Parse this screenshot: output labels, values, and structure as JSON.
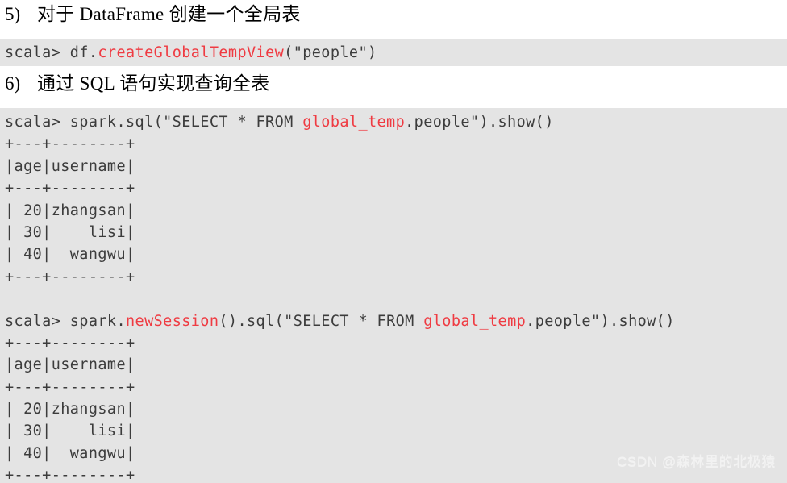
{
  "document": {
    "background_color": "#ffffff",
    "code_block_color": "#e4e4e4",
    "code_text_color": "#3c3c3c",
    "accent_color": "#ef3b42"
  },
  "headings": [
    {
      "number": "5)",
      "text": "对于 DataFrame 创建一个全局表"
    },
    {
      "number": "6)",
      "text": "通过 SQL 语句实现查询全表"
    }
  ],
  "code_block_1": {
    "lines": [
      {
        "segments": [
          {
            "text": "scala> df.",
            "color": "plain"
          },
          {
            "text": "createGlobalTempView",
            "color": "red"
          },
          {
            "text": "(\"people\")",
            "color": "plain"
          }
        ]
      }
    ]
  },
  "code_block_2": {
    "lines": [
      {
        "segments": [
          {
            "text": "scala> spark.sql(\"SELECT * FROM ",
            "color": "plain"
          },
          {
            "text": "global_temp",
            "color": "red"
          },
          {
            "text": ".people\").show()",
            "color": "plain"
          }
        ]
      },
      {
        "segments": [
          {
            "text": "+---+--------+",
            "color": "plain"
          }
        ]
      },
      {
        "segments": [
          {
            "text": "|age|username|",
            "color": "plain"
          }
        ]
      },
      {
        "segments": [
          {
            "text": "+---+--------+",
            "color": "plain"
          }
        ]
      },
      {
        "segments": [
          {
            "text": "| 20|zhangsan|",
            "color": "plain"
          }
        ]
      },
      {
        "segments": [
          {
            "text": "| 30|    lisi|",
            "color": "plain"
          }
        ]
      },
      {
        "segments": [
          {
            "text": "| 40|  wangwu|",
            "color": "plain"
          }
        ]
      },
      {
        "segments": [
          {
            "text": "+---+--------+",
            "color": "plain"
          }
        ]
      },
      {
        "segments": [
          {
            "text": "",
            "color": "plain"
          }
        ]
      },
      {
        "segments": [
          {
            "text": "scala> spark.",
            "color": "plain"
          },
          {
            "text": "newSession",
            "color": "red"
          },
          {
            "text": "().sql(\"SELECT * FROM ",
            "color": "plain"
          },
          {
            "text": "global_temp",
            "color": "red"
          },
          {
            "text": ".people\").show()",
            "color": "plain"
          }
        ]
      },
      {
        "segments": [
          {
            "text": "+---+--------+",
            "color": "plain"
          }
        ]
      },
      {
        "segments": [
          {
            "text": "|age|username|",
            "color": "plain"
          }
        ]
      },
      {
        "segments": [
          {
            "text": "+---+--------+",
            "color": "plain"
          }
        ]
      },
      {
        "segments": [
          {
            "text": "| 20|zhangsan|",
            "color": "plain"
          }
        ]
      },
      {
        "segments": [
          {
            "text": "| 30|    lisi|",
            "color": "plain"
          }
        ]
      },
      {
        "segments": [
          {
            "text": "| 40|  wangwu|",
            "color": "plain"
          }
        ]
      },
      {
        "segments": [
          {
            "text": "+---+--------+",
            "color": "plain"
          }
        ]
      }
    ],
    "result_table": {
      "columns": [
        "age",
        "username"
      ],
      "rows": [
        [
          "20",
          "zhangsan"
        ],
        [
          "30",
          "lisi"
        ],
        [
          "40",
          "wangwu"
        ]
      ]
    }
  },
  "watermark": {
    "text": "CSDN @森林里的北极猿"
  }
}
